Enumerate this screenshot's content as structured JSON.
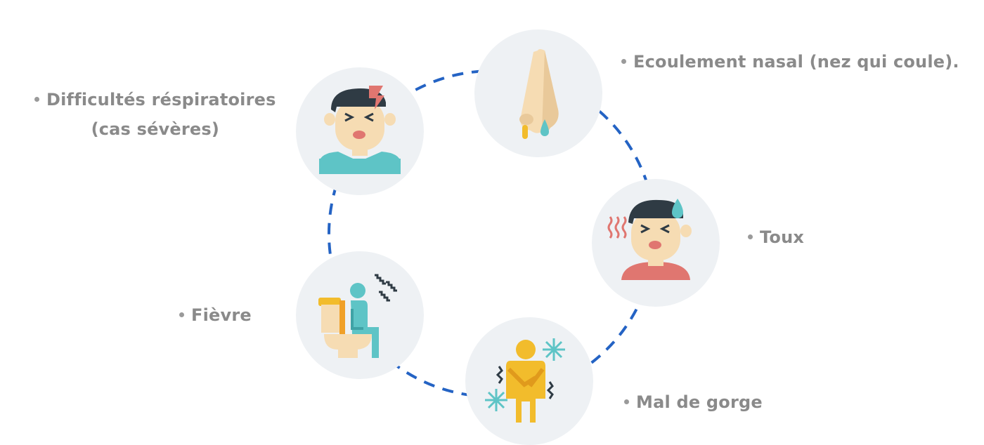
{
  "colors": {
    "ring": "#2463c4",
    "node_bg": "#eef1f4",
    "label_text": "#8a8a8a",
    "skin": "#f6dcb3",
    "hair": "#2f3b44",
    "teal": "#5ec4c6",
    "red": "#e07670",
    "yellow": "#f2bc2c",
    "orange": "#f0a028"
  },
  "symptoms": [
    {
      "label": "Ecoulement nasal (nez qui coule).",
      "icon": "runny-nose-icon"
    },
    {
      "label": "Toux",
      "icon": "sick-sweating-face-icon"
    },
    {
      "label": "Mal de gorge",
      "icon": "shivering-cold-person-icon"
    },
    {
      "label": "Fièvre",
      "icon": "person-on-toilet-icon"
    },
    {
      "label_line1": "Difficultés réspiratoires",
      "label_line2": "(cas sévères)",
      "icon": "headache-face-icon"
    }
  ]
}
